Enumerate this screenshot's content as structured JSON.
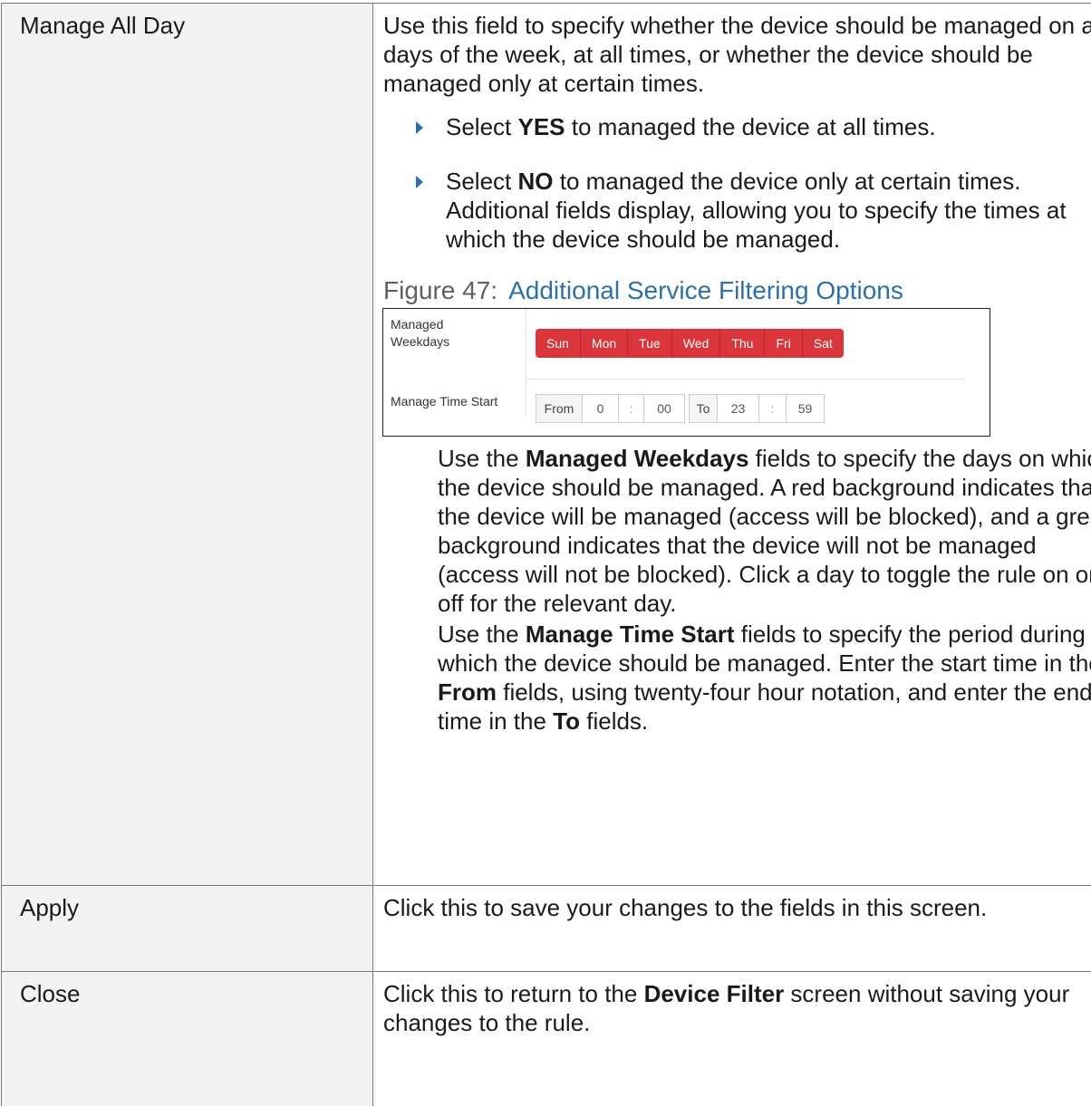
{
  "rows": [
    {
      "label": "Manage All Day",
      "intro": "Use this field to specify whether the device should be managed on all days of the week, at all times, or whether the device should be managed only at certain times.",
      "bullets": [
        {
          "pre": "Select ",
          "bold": "YES",
          "post": " to managed the device at all times."
        },
        {
          "pre": "Select ",
          "bold": "NO",
          "post": " to managed the device only at certain times. Additional fields display, allowing you to specify the times at which the device should be managed."
        }
      ],
      "figure": {
        "number": "Figure 47:",
        "title": "Additional Service Filtering Options",
        "weekdays_label": "Managed Weekdays",
        "days": [
          "Sun",
          "Mon",
          "Tue",
          "Wed",
          "Thu",
          "Fri",
          "Sat"
        ],
        "day_color": "#d9353b",
        "time_label": "Manage Time Start",
        "from_label": "From",
        "from_hour": "0",
        "from_minute": "00",
        "to_label": "To",
        "to_hour": "23",
        "to_minute": "59",
        "separator": ":"
      },
      "weekdays_para": {
        "pre": "Use the ",
        "bold": "Managed Weekdays",
        "post": " fields to specify the days on which the device should be managed. A red background indicates that the device will be managed (access will be blocked), and a green background indicates that the device will not be managed (access will not be blocked). Click a day to toggle the rule on or off for the relevant day."
      },
      "time_para": {
        "pre": "Use the ",
        "bold1": "Manage Time Start",
        "mid1": " fields to specify the period during which the device should be managed. Enter the start time in the ",
        "bold2": "From",
        "mid2": " fields, using twenty-four hour notation, and enter the end time in the ",
        "bold3": "To",
        "post": " fields."
      }
    },
    {
      "label": "Apply",
      "desc": "Click this to save your changes to the fields in this screen."
    },
    {
      "label": "Close",
      "pre": "Click this to return to the ",
      "bold": "Device Filter",
      "post": " screen without saving your changes to the rule."
    }
  ],
  "colors": {
    "label_bg": "#f2f2f2",
    "accent_blue": "#2e6fa7",
    "border": "#777777"
  }
}
